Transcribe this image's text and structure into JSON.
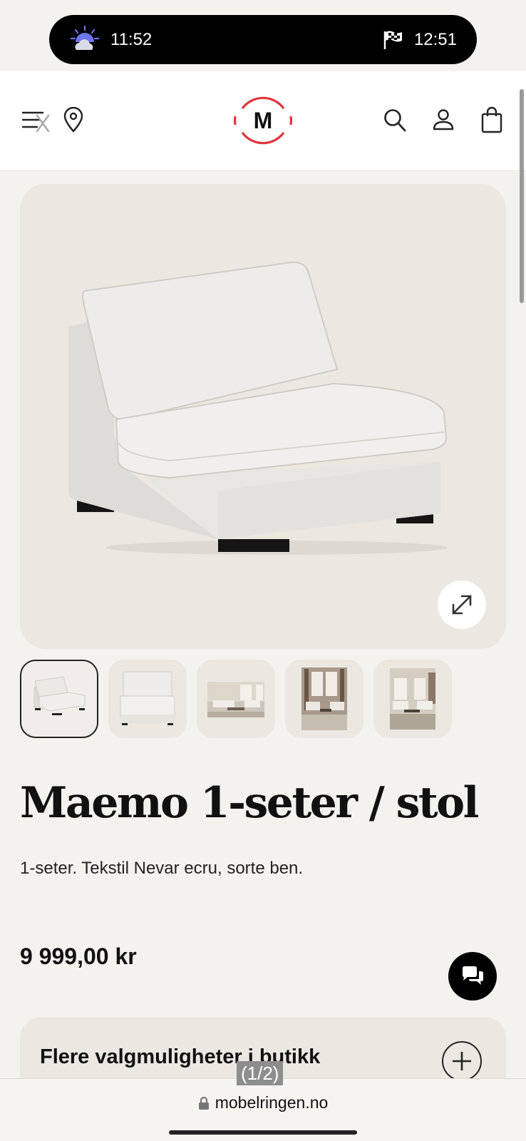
{
  "status_bar": {
    "time_left": "11:52",
    "time_right": "12:51",
    "left_icon": "weather-moon-cloud-icon",
    "right_icon": "checkered-flag-icon"
  },
  "header": {
    "logo_letter": "M",
    "logo_color": "#e0363c",
    "icons": [
      "menu-close-icon",
      "location-pin-icon",
      "search-icon",
      "account-icon",
      "shopping-bag-icon"
    ]
  },
  "product": {
    "title": "Maemo 1-seter / stol",
    "description": "1-seter. Tekstil Nevar ecru, sorte ben.",
    "price": "9 999,00 kr",
    "thumbnail_count": 5
  },
  "options": {
    "label": "Flere valgmuligheter i butikk"
  },
  "browser": {
    "url": "mobelringen.no",
    "page_counter": "(1/2)"
  }
}
